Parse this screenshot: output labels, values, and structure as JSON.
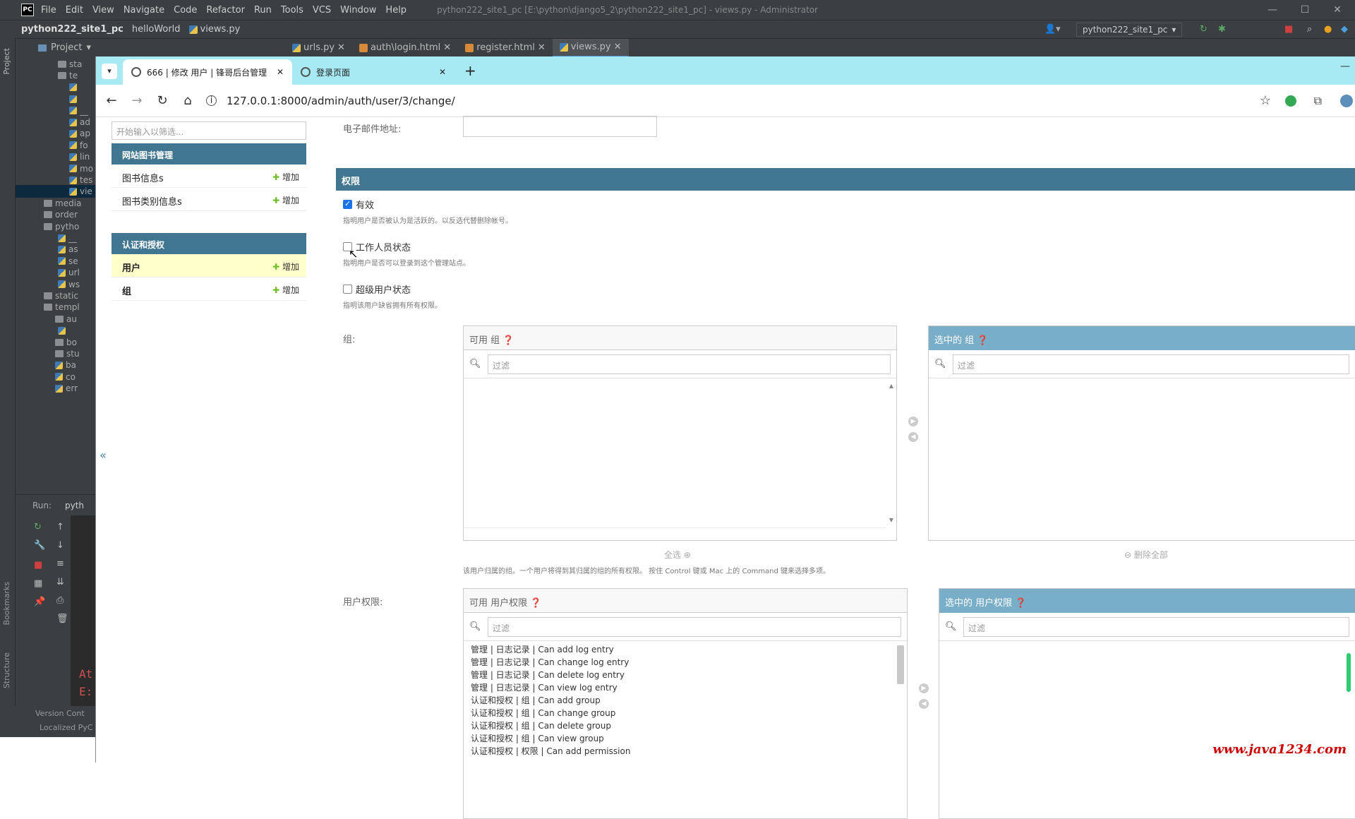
{
  "ide": {
    "logo": "PC",
    "menu": [
      "File",
      "Edit",
      "View",
      "Navigate",
      "Code",
      "Refactor",
      "Run",
      "Tools",
      "VCS",
      "Window",
      "Help"
    ],
    "window_title": "python222_site1_pc [E:\\python\\django5_2\\python222_site1_pc] - views.py - Administrator",
    "breadcrumb": [
      "python222_site1_pc",
      "helloWorld",
      "views.py"
    ],
    "run_config": "python222_site1_pc",
    "project_label": "Project",
    "editor_tabs": [
      {
        "label": "urls.py",
        "icon": "python-file-icon"
      },
      {
        "label": "auth\\login.html",
        "icon": "html-file-icon"
      },
      {
        "label": "register.html",
        "icon": "html-file-icon"
      },
      {
        "label": "views.py",
        "icon": "python-file-icon"
      }
    ],
    "tree": [
      "sta",
      "te",
      "",
      "",
      "__",
      "ad",
      "ap",
      "fo",
      "lin",
      "mo",
      "tes",
      "vie",
      "media",
      "order",
      "pytho",
      "__",
      "as",
      "se",
      "url",
      "ws",
      "static",
      "templ",
      "au",
      "",
      "bo",
      "stu",
      "ba",
      "co",
      "err"
    ],
    "run_label": "Run:",
    "run_tab": "pyth",
    "console": [
      "At",
      "E:"
    ],
    "side_labels": {
      "project": "Project",
      "bookmarks": "Bookmarks",
      "structure": "Structure"
    },
    "bottom": [
      "Version Cont",
      "Localized PyC"
    ]
  },
  "browser": {
    "tabs": [
      {
        "title": "666 | 修改 用户 | 锋哥后台管理",
        "active": true
      },
      {
        "title": "登录页面",
        "active": false
      }
    ],
    "url": "127.0.0.1:8000/admin/auth/user/3/change/"
  },
  "sidebar": {
    "filter_placeholder": "开始输入以筛选...",
    "modules": [
      {
        "title": "网站图书管理",
        "items": [
          {
            "label": "图书信息s",
            "add": "增加"
          },
          {
            "label": "图书类别信息s",
            "add": "增加"
          }
        ]
      },
      {
        "title": "认证和授权",
        "items": [
          {
            "label": "用户",
            "add": "增加",
            "selected": true
          },
          {
            "label": "组",
            "add": "增加"
          }
        ]
      }
    ],
    "collapse": "«"
  },
  "form": {
    "email_label": "电子邮件地址:",
    "perm_header": "权限",
    "active": {
      "label": "有效",
      "checked": true,
      "help": "指明用户是否被认为是活跃的。以反选代替删除帐号。"
    },
    "staff": {
      "label": "工作人员状态",
      "checked": false,
      "help": "指明用户是否可以登录到这个管理站点。"
    },
    "superuser": {
      "label": "超级用户状态",
      "checked": false,
      "help": "指明该用户缺省拥有所有权限。"
    },
    "groups": {
      "label": "组:",
      "available_title": "可用 组",
      "chosen_title": "选中的 组",
      "filter_placeholder": "过滤",
      "choose_all": "全选",
      "remove_all": "删除全部",
      "help": "该用户归属的组。一个用户将得到其归属的组的所有权限。 按住 Control 键或 Mac 上的 Command 键来选择多项。"
    },
    "permissions": {
      "label": "用户权限:",
      "available_title": "可用 用户权限",
      "chosen_title": "选中的 用户权限",
      "filter_placeholder": "过滤",
      "options": [
        "管理 | 日志记录 | Can add log entry",
        "管理 | 日志记录 | Can change log entry",
        "管理 | 日志记录 | Can delete log entry",
        "管理 | 日志记录 | Can view log entry",
        "认证和授权 | 组 | Can add group",
        "认证和授权 | 组 | Can change group",
        "认证和授权 | 组 | Can delete group",
        "认证和授权 | 组 | Can view group",
        "认证和授权 | 权限 | Can add permission"
      ]
    }
  },
  "watermark": "www.java1234.com",
  "colors": {
    "django_header": "#417690",
    "chosen_header": "#79aec8",
    "tab_bar": "#a7eaf4",
    "ide_bg": "#3c3f41",
    "selected_row": "#ffffcc"
  }
}
